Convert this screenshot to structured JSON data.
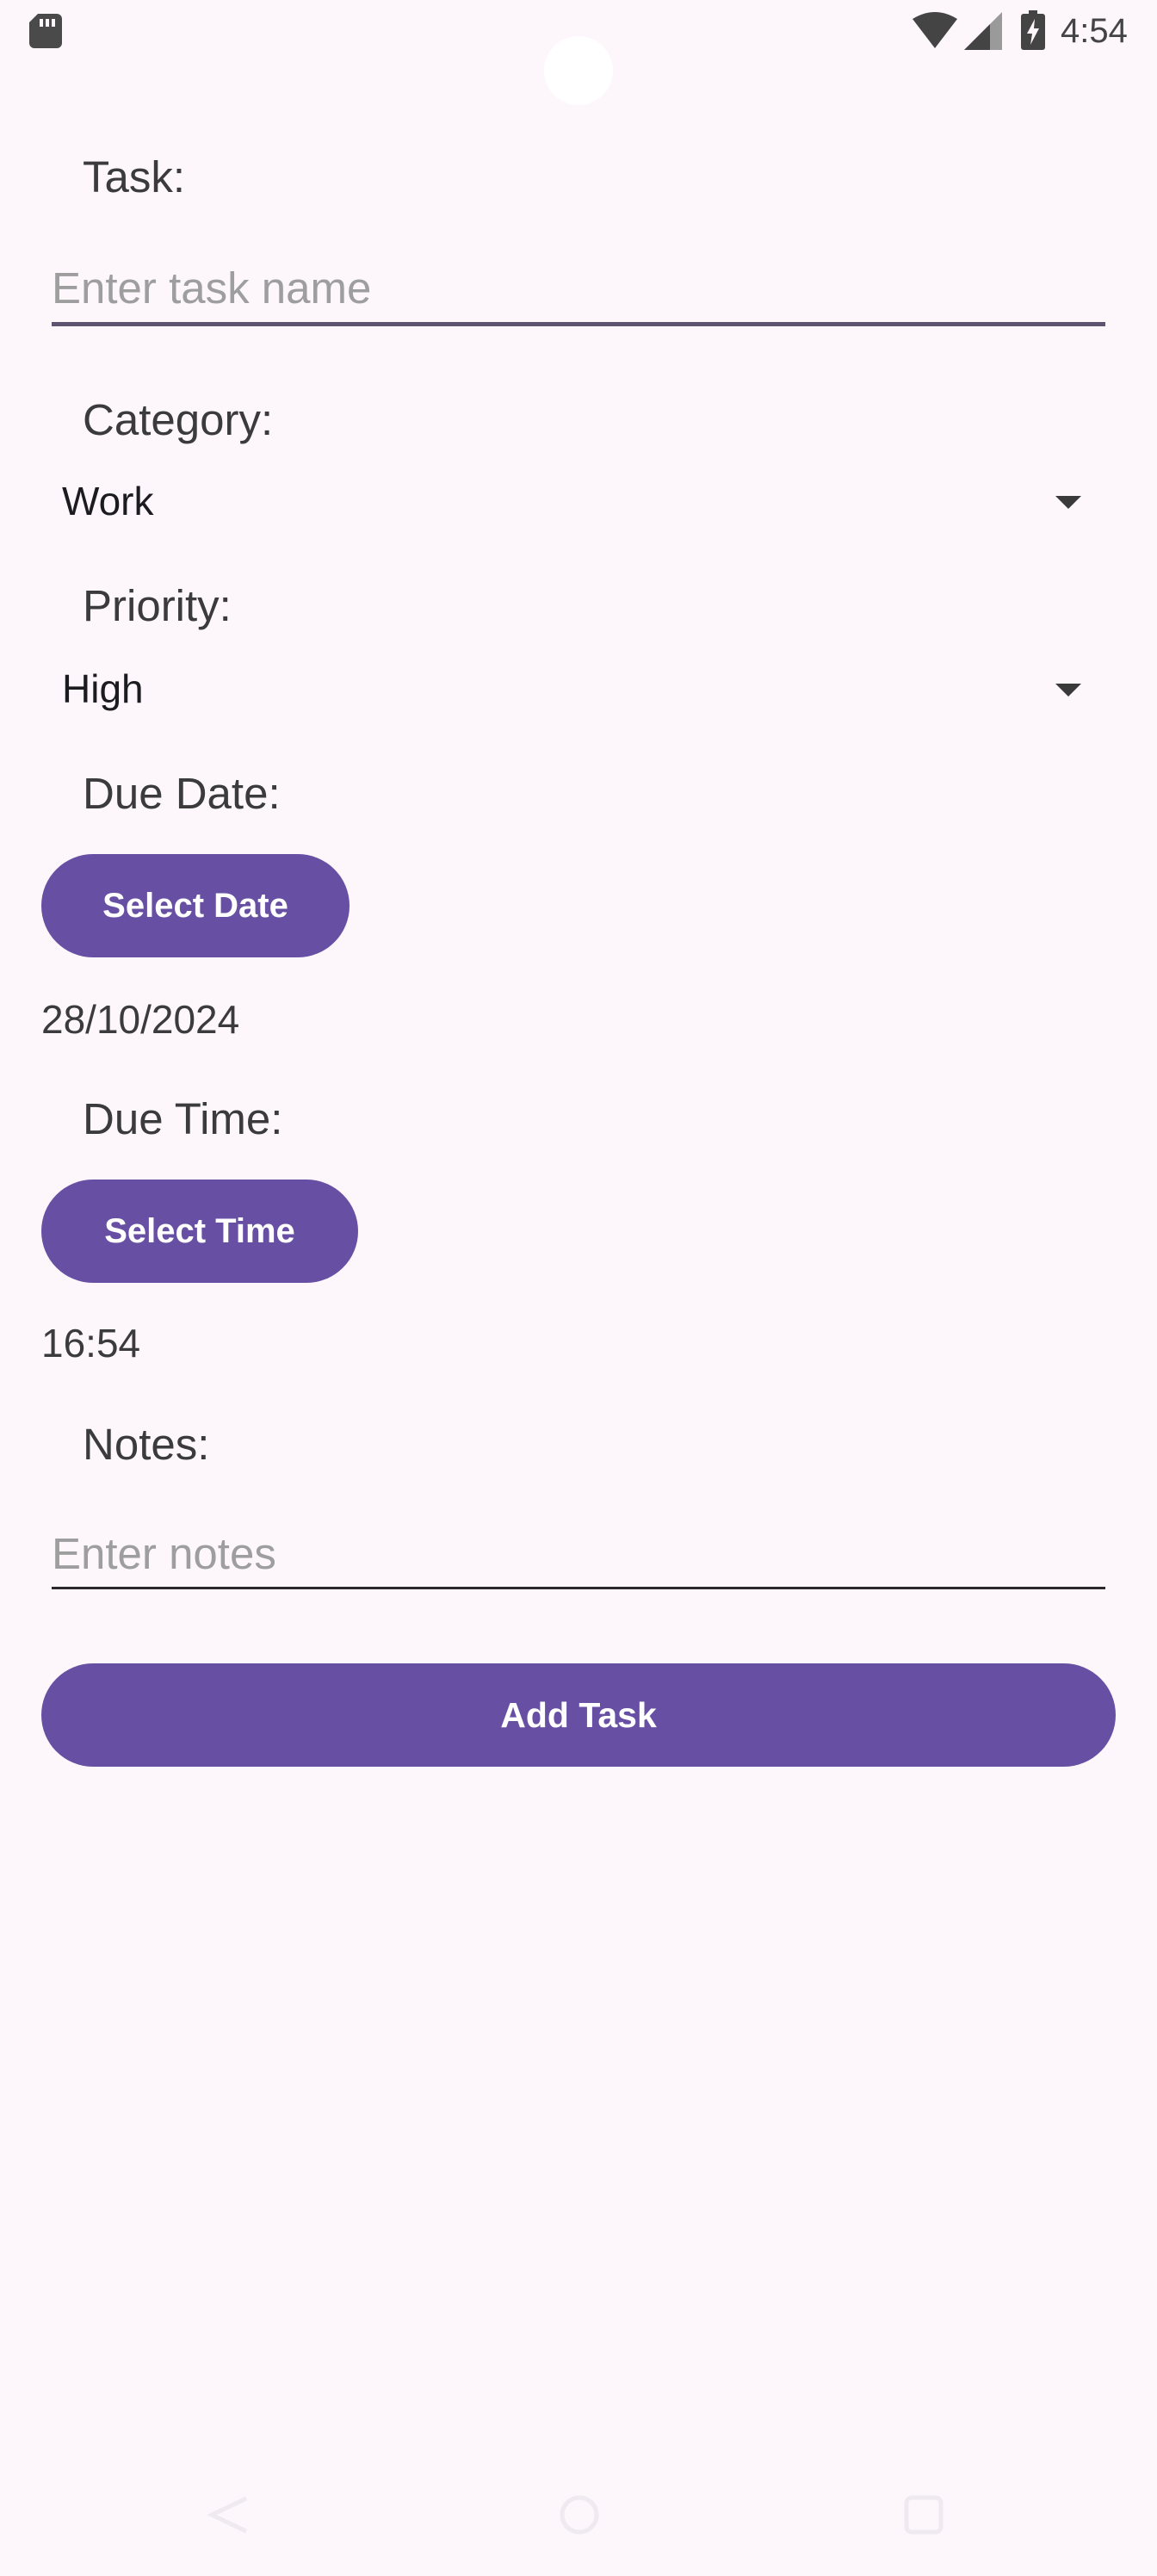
{
  "status_bar": {
    "time": "4:54",
    "icons": [
      "sd-card-icon",
      "wifi-icon",
      "cell-signal-icon",
      "battery-charging-icon"
    ]
  },
  "form": {
    "task": {
      "label": "Task:",
      "value": "",
      "placeholder": "Enter task name"
    },
    "category": {
      "label": "Category:",
      "selected": "Work"
    },
    "priority": {
      "label": "Priority:",
      "selected": "High"
    },
    "due_date": {
      "label": "Due Date:",
      "button_label": "Select Date",
      "value": "28/10/2024"
    },
    "due_time": {
      "label": "Due Time:",
      "button_label": "Select Time",
      "value": "16:54"
    },
    "notes": {
      "label": "Notes:",
      "value": "",
      "placeholder": "Enter notes"
    },
    "submit_label": "Add Task"
  },
  "nav_bar": {
    "icons": [
      "back-icon",
      "home-icon",
      "recents-icon"
    ]
  },
  "colors": {
    "background": "#fdf7fc",
    "primary": "#6750a4",
    "on_primary": "#ffffff",
    "label_text": "#3b3b3b",
    "placeholder": "#9e9e9e"
  }
}
